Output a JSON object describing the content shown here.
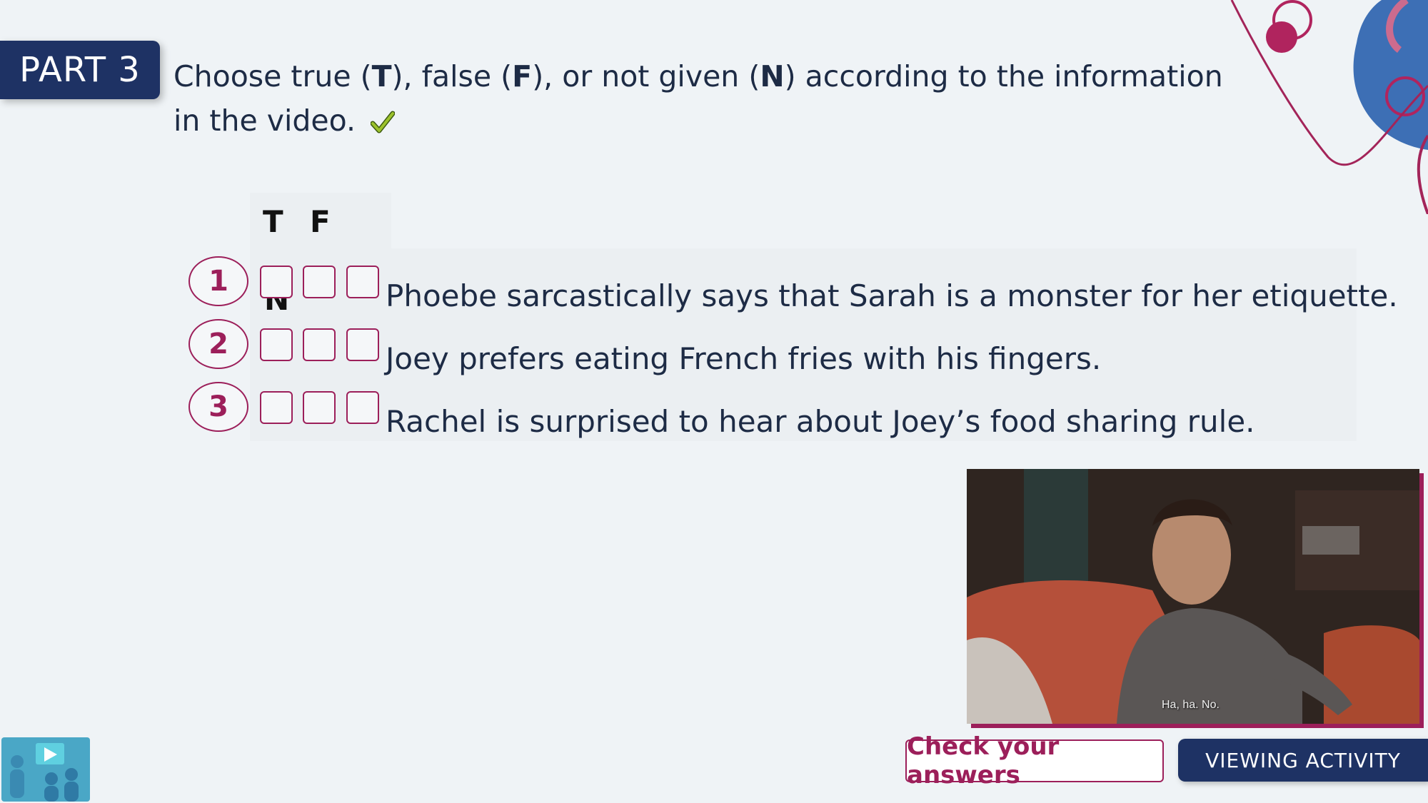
{
  "header": {
    "part_label": "PART 3",
    "instruction": {
      "t1": "Choose true (",
      "T": "T",
      "t2": "), false (",
      "F": "F",
      "t3": "), or not given (",
      "N": "N",
      "t4": ") according to the information in the video."
    }
  },
  "quiz": {
    "columns": [
      "T",
      "F",
      "N"
    ],
    "questions": [
      {
        "number": "1",
        "text": "Phoebe sarcastically says that Sarah is a monster for her etiquette."
      },
      {
        "number": "2",
        "text": "Joey prefers eating French fries with his fingers."
      },
      {
        "number": "3",
        "text": "Rachel is surprised to hear about Joey’s food sharing rule."
      }
    ]
  },
  "video": {
    "subtitle": "Ha, ha. No."
  },
  "buttons": {
    "check": "Check your answers",
    "viewing": "VIEWING ACTIVITY"
  },
  "icons": {
    "check": "checkmark-icon",
    "logo": "video-group-icon"
  },
  "colors": {
    "navy": "#1e3264",
    "accent": "#9c1f5a",
    "background": "#eff3f6"
  }
}
